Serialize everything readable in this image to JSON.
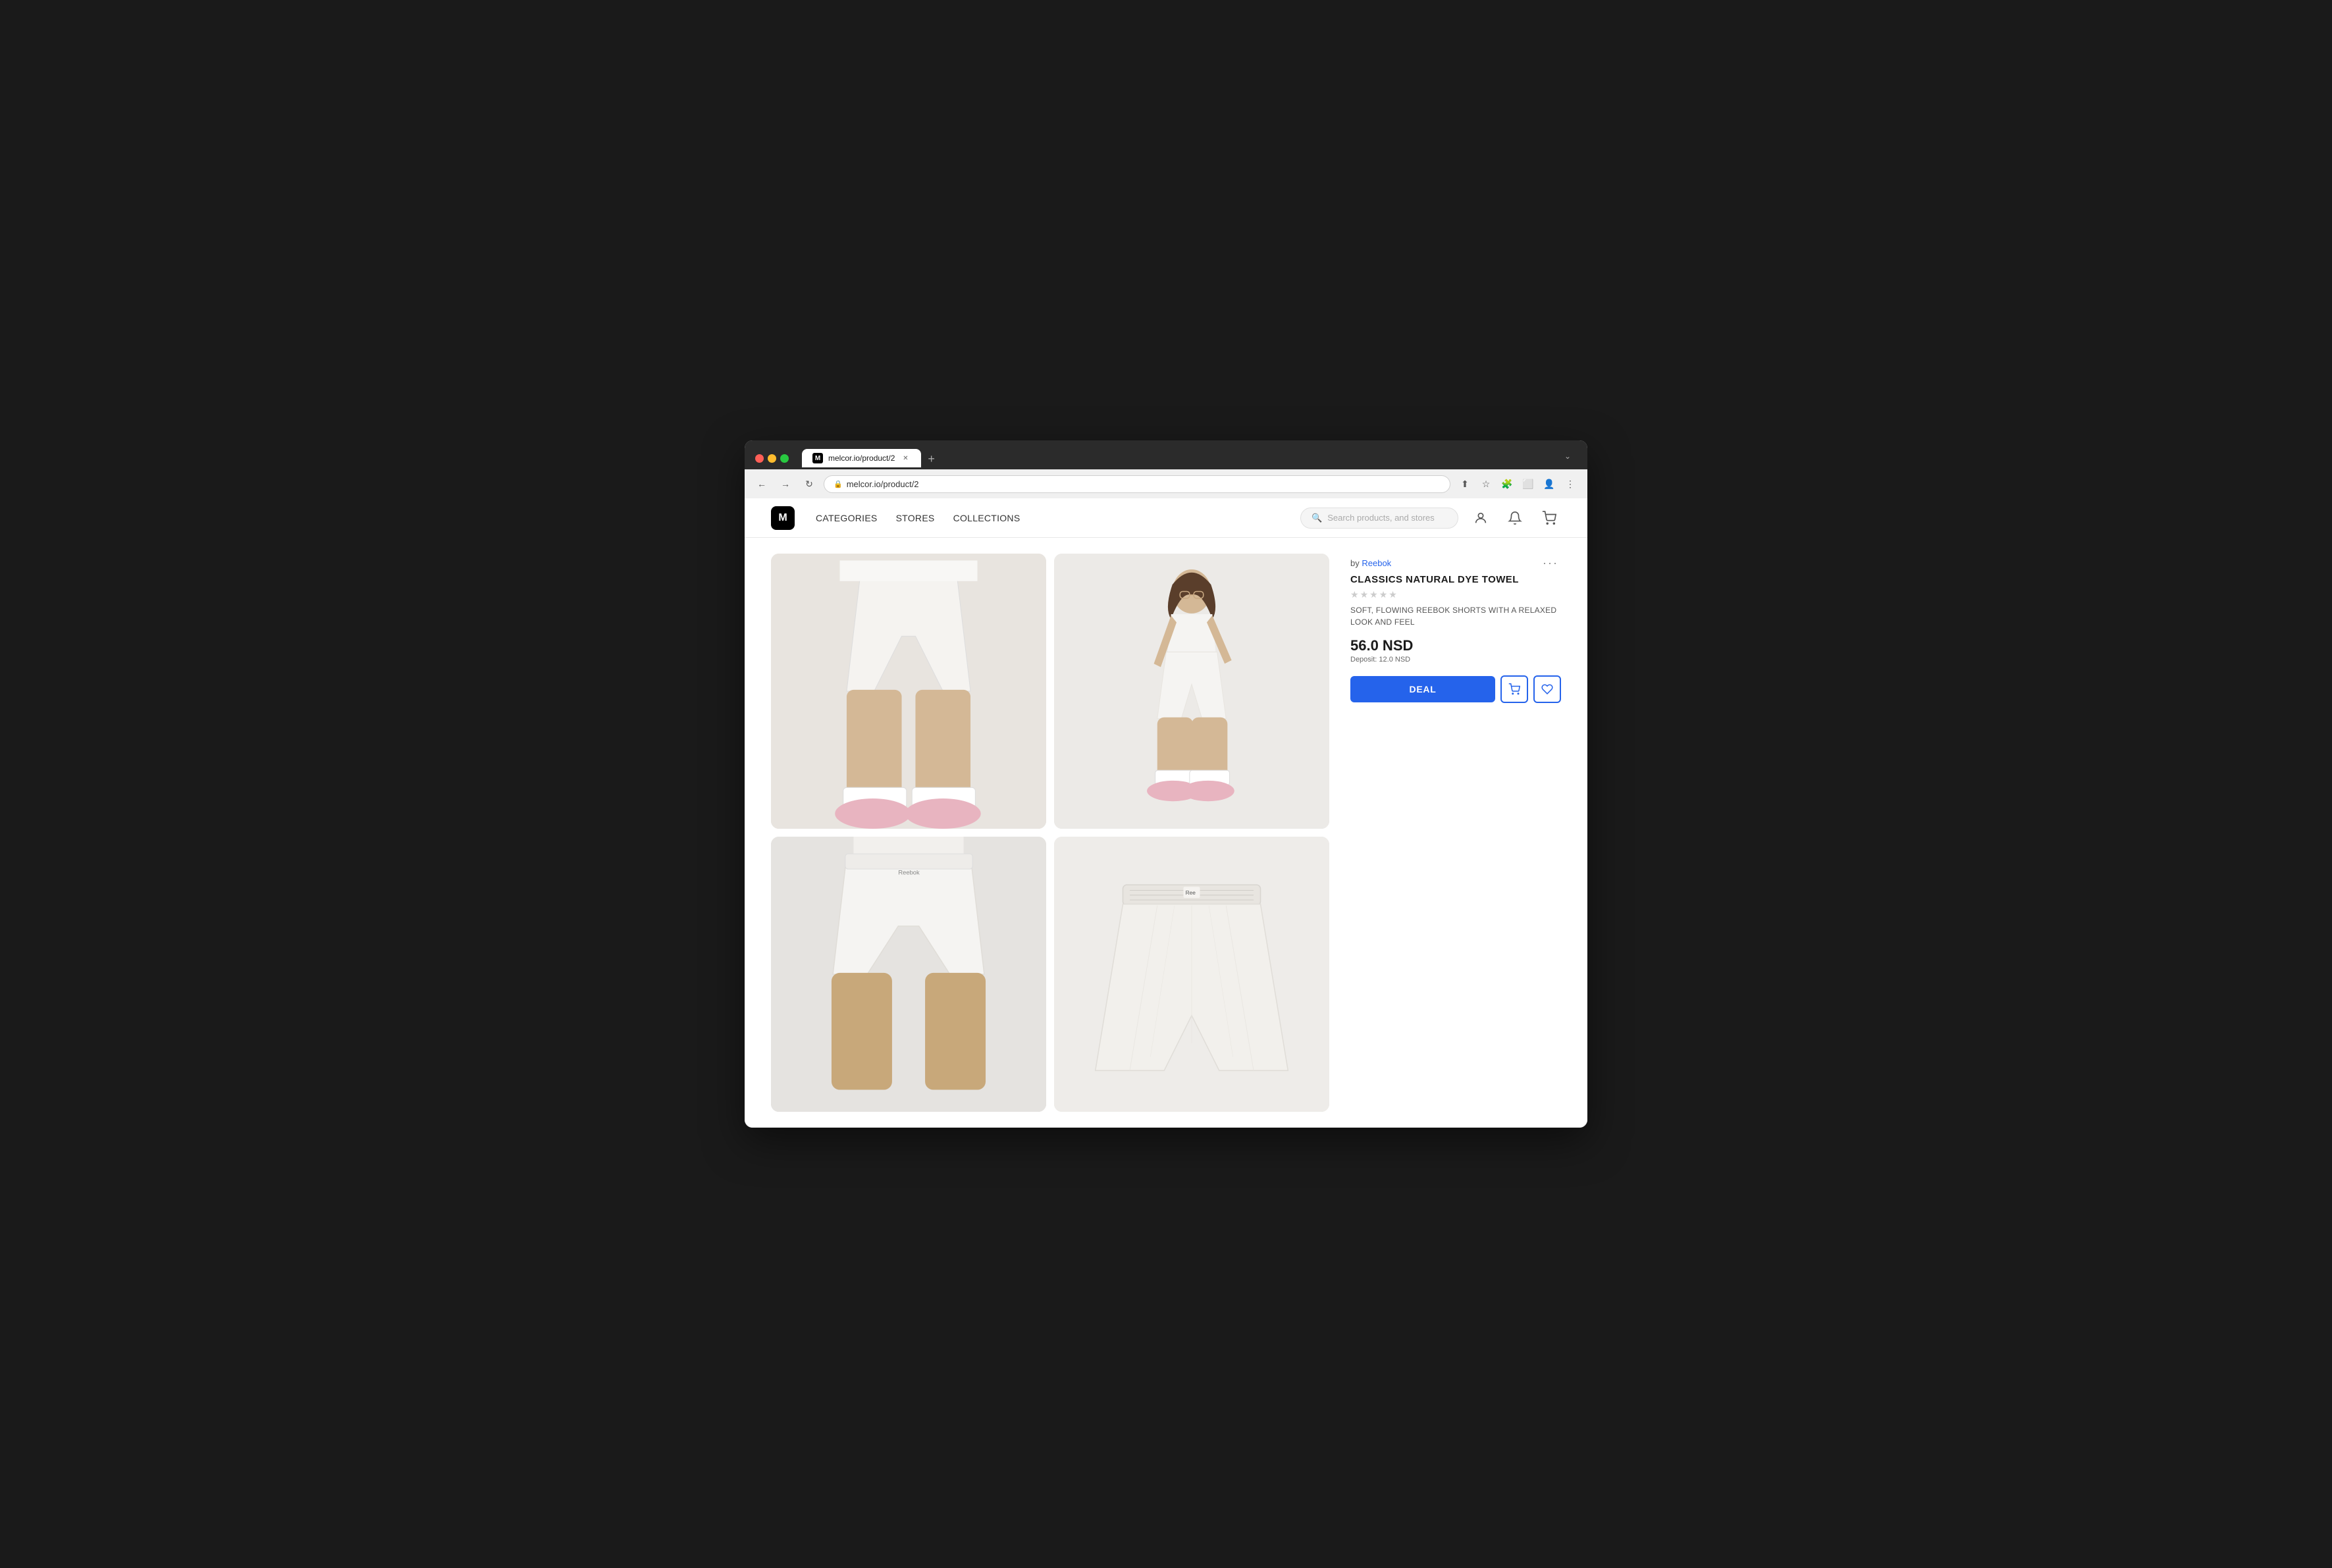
{
  "browser": {
    "tab_url": "melcor.io/product/2",
    "tab_title": "melcor.io/product/2",
    "tab_favicon": "M",
    "address": "melcor.io/product/2"
  },
  "header": {
    "logo_text": "M",
    "nav": {
      "categories": "CATEGORIES",
      "stores": "STORES",
      "collections": "COLLECTIONS"
    },
    "search_placeholder": "Search products, and stores"
  },
  "product": {
    "brand_label": "by",
    "brand_name": "Reebok",
    "title": "CLASSICS NATURAL DYE TOWEL",
    "description": "SOFT, FLOWING REEBOK SHORTS WITH A RELAXED LOOK AND FEEL",
    "price": "56.0 NSD",
    "deposit_label": "Deposit:",
    "deposit_value": "12.0 NSD",
    "deal_button": "DEAL",
    "rating_stars": 5,
    "images": [
      {
        "id": "img1",
        "alt": "Product front view"
      },
      {
        "id": "img2",
        "alt": "Product model view"
      },
      {
        "id": "img3",
        "alt": "Product detail view"
      },
      {
        "id": "img4",
        "alt": "Product flat lay"
      }
    ]
  }
}
